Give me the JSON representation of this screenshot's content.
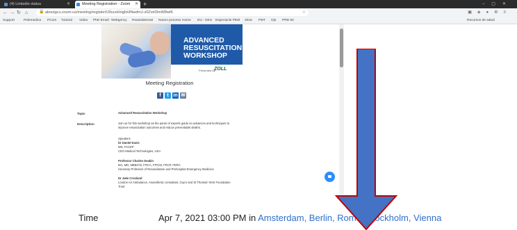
{
  "browser": {
    "tabs": [
      {
        "title": "(4) Linkedin status"
      },
      {
        "title": "Meeting Registration - Zoom"
      }
    ],
    "new_tab_icon": "plus-icon",
    "url": "aboutgcu.zoom.us/meeting/register/tJ0uceHrqjIoHNwdmJ-x0Zvef3mW8wIK",
    "bookmarks": [
      "Support",
      "Pelemedica",
      "PCom",
      "Tutorial",
      "Video",
      "PhD Email",
      "Webgency",
      "Rosasistemati",
      "Nuevo proceso",
      "Home",
      "DU - DKS",
      "Espectacle PEM",
      "2016",
      "FMT",
      "Ojo",
      "PRD 64",
      "Recursos de salud"
    ]
  },
  "banner": {
    "title_line1": "ADVANCED",
    "title_line2": "RESUSCITATION",
    "title_line3": "WORKSHOP",
    "presented_by": "Presented by",
    "sponsor": "ZOLL"
  },
  "page": {
    "meeting_registration": "Meeting Registration",
    "topic_label": "Topic",
    "topic_value": "Advanced Resuscitation Workshop",
    "description_label": "Description",
    "description_intro": "Join us for this workshop as the panel of experts guide on advances and techniques to improve resuscitation outcomes and reduce preventable deaths.",
    "speakers_heading": "Speakers",
    "speaker1_name": "Dr Daniel Davis",
    "speaker1_title": "MD, FACEP",
    "speaker1_org": "CEO Medical Technologies, USA",
    "speaker2_name": "Professor Charles Deakin",
    "speaker2_creds": "MA, MD, MBBChir, FRCA, FFICM, FRCP, FERC",
    "speaker2_role": "Honorary Professor of Resuscitation and Prehospital Emergency Medicine",
    "speaker3_name": "Dr Jake Crosland",
    "speaker3_role": "London Air Ambulance, Anaesthetic consultant, Guy's and St Thomas' NHS Foundation Trust"
  },
  "zoom_text": {
    "time_label": "Time",
    "time_value": "Apr 7, 2021 03:00 PM in ",
    "timezone": "Amsterdam, Berlin, Rome, Stockholm, Vienna"
  },
  "annotation": {
    "arrow_color": "#4472c4",
    "arrow_border": "#c00000"
  }
}
